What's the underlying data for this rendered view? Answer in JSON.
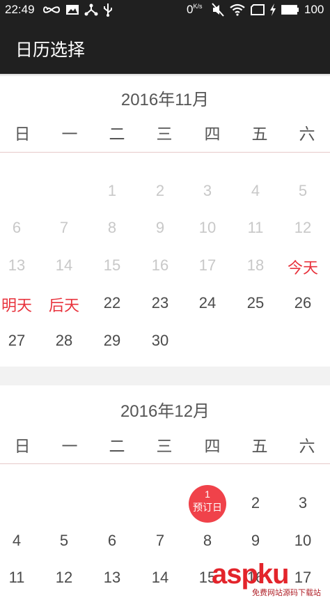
{
  "status_bar": {
    "time": "22:49",
    "net_speed": "0",
    "net_speed_unit": "K/s",
    "battery": "100",
    "icons": [
      "infinity-icon",
      "image-icon",
      "share-icon",
      "usb-icon",
      "mute-icon",
      "wifi-icon",
      "no-sim-icon",
      "charging-icon"
    ]
  },
  "app_bar": {
    "title": "日历选择"
  },
  "weekdays": [
    "日",
    "一",
    "二",
    "三",
    "四",
    "五",
    "六"
  ],
  "months": [
    {
      "title": "2016年11月",
      "weeks": [
        [
          "",
          "",
          "1",
          "2",
          "3",
          "4",
          "5"
        ],
        [
          "6",
          "7",
          "8",
          "9",
          "10",
          "11",
          "12"
        ],
        [
          "13",
          "14",
          "15",
          "16",
          "17",
          "18",
          "今天"
        ],
        [
          "明天",
          "后天",
          "22",
          "23",
          "24",
          "25",
          "26"
        ],
        [
          "27",
          "28",
          "29",
          "30",
          "",
          "",
          ""
        ]
      ]
    },
    {
      "title": "2016年12月",
      "weeks": [
        [
          "",
          "",
          "",
          "",
          "",
          "2",
          "3"
        ],
        [
          "4",
          "5",
          "6",
          "7",
          "8",
          "9",
          "10"
        ],
        [
          "11",
          "12",
          "13",
          "14",
          "15",
          "16",
          "17"
        ]
      ],
      "booked_day": {
        "number": "1",
        "label": "预订日"
      }
    }
  ],
  "watermark": {
    "brand": "aspku",
    "sub": "免费网站源码下载站"
  },
  "colors": {
    "bar": "#202020",
    "label_red": "#e8323c",
    "booked_red": "#f0424a",
    "past_gray": "#c8c8c8"
  }
}
